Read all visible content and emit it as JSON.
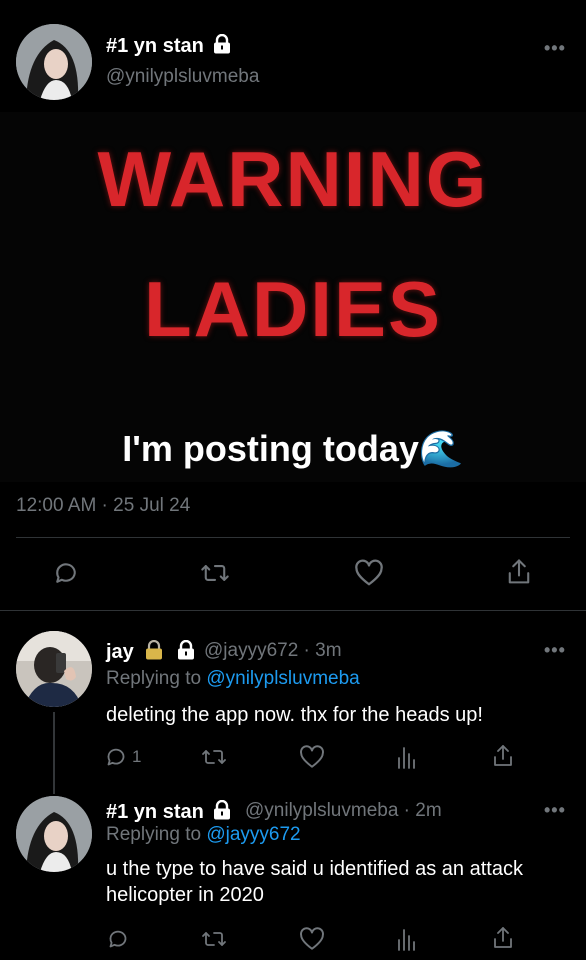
{
  "main_tweet": {
    "display_name": "#1 yn stan",
    "handle": "@ynilyplsluvmeba",
    "media": {
      "line1": "WARNING",
      "line2": "LADIES",
      "caption": "I'm posting today🌊"
    },
    "timestamp": "12:00 AM · 25 Jul 24",
    "more": "•••"
  },
  "reply1": {
    "display_name": "jay",
    "handle": "@jayyy672 · 3m",
    "replying_prefix": "Replying to ",
    "replying_to": "@ynilyplsluvmeba",
    "text": "deleting the app now. thx for the heads up!",
    "reply_count": "1",
    "more": "•••"
  },
  "reply2": {
    "display_name": "#1 yn stan",
    "handle": "@ynilyplsluvmeba · 2m",
    "replying_prefix": "Replying to ",
    "replying_to": "@jayyy672",
    "text": "u the type to have said u identified as an attack helicopter in 2020",
    "more": "•••"
  },
  "icons": [
    "reply-icon",
    "retweet-icon",
    "like-icon",
    "views-icon",
    "share-icon",
    "lock-icon"
  ],
  "colors": {
    "background": "#000000",
    "muted": "#71767b",
    "link": "#1d9bf0",
    "warning_red": "#d8262b"
  }
}
